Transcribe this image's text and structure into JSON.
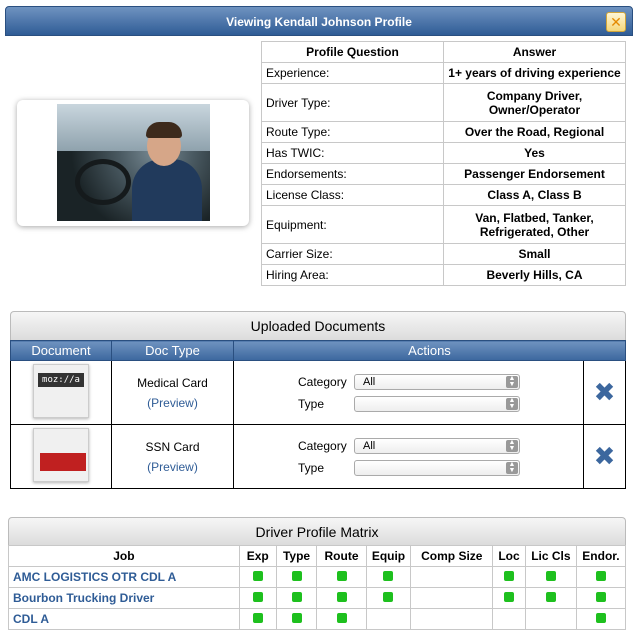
{
  "dialog": {
    "title": "Viewing Kendall Johnson Profile",
    "close_icon": "close-icon",
    "accent": "#2f5c96"
  },
  "profile": {
    "headers": {
      "question": "Profile Question",
      "answer": "Answer"
    },
    "rows": [
      {
        "q": "Experience:",
        "a": "1+ years of driving experience"
      },
      {
        "q": "Driver Type:",
        "a": "Company Driver, Owner/Operator"
      },
      {
        "q": "Route Type:",
        "a": "Over the Road, Regional"
      },
      {
        "q": "Has TWIC:",
        "a": "Yes"
      },
      {
        "q": "Endorsements:",
        "a": "Passenger Endorsement"
      },
      {
        "q": "License Class:",
        "a": "Class A, Class B"
      },
      {
        "q": "Equipment:",
        "a": "Van, Flatbed, Tanker, Refrigerated, Other"
      },
      {
        "q": "Carrier Size:",
        "a": "Small"
      },
      {
        "q": "Hiring Area:",
        "a": "Beverly Hills, CA"
      }
    ]
  },
  "documents": {
    "title": "Uploaded Documents",
    "headers": {
      "document": "Document",
      "doc_type": "Doc Type",
      "actions": "Actions"
    },
    "rows": [
      {
        "doc_type": "Medical Card",
        "preview": "(Preview)",
        "category_label": "Category",
        "category_value": "All",
        "type_label": "Type",
        "type_value": ""
      },
      {
        "doc_type": "SSN Card",
        "preview": "(Preview)",
        "category_label": "Category",
        "category_value": "All",
        "type_label": "Type",
        "type_value": ""
      }
    ],
    "thumb_text": "moz://a"
  },
  "matrix": {
    "title": "Driver Profile Matrix",
    "headers": [
      "Job",
      "Exp",
      "Type",
      "Route",
      "Equip",
      "Comp Size",
      "Loc",
      "Lic Cls",
      "Endor."
    ],
    "rows": [
      {
        "job": "AMC LOGISTICS OTR CDL A",
        "checks": [
          true,
          true,
          true,
          true,
          false,
          true,
          true,
          true
        ]
      },
      {
        "job": "Bourbon Trucking Driver",
        "checks": [
          true,
          true,
          true,
          true,
          false,
          true,
          true,
          true
        ]
      },
      {
        "job": "CDL A",
        "checks": [
          true,
          true,
          true,
          false,
          false,
          false,
          false,
          true
        ]
      }
    ],
    "check_color": "#1ec01e"
  }
}
